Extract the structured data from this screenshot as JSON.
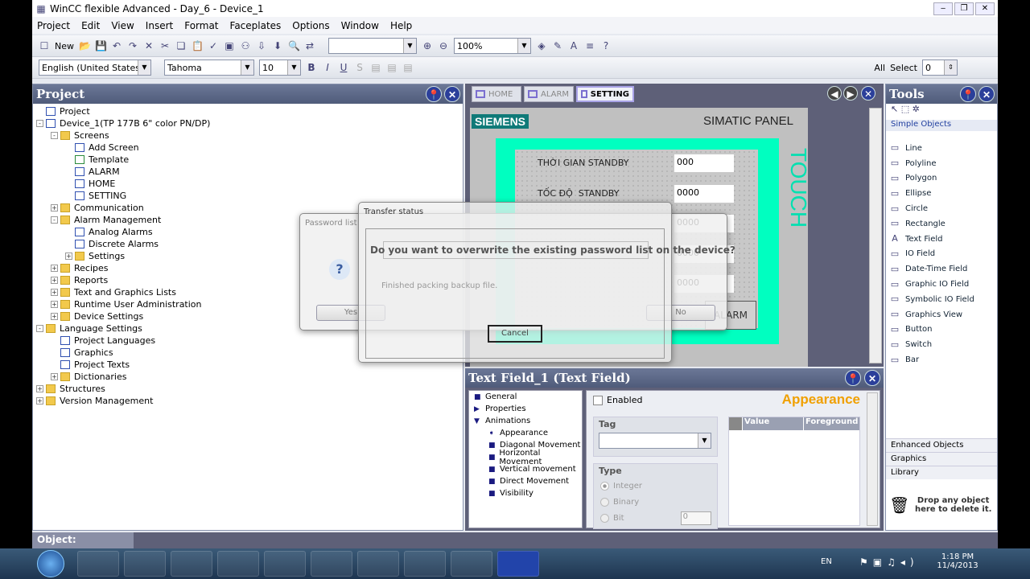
{
  "window": {
    "title": "WinCC flexible Advanced - Day_6 - Device_1"
  },
  "menu": [
    "Project",
    "Edit",
    "View",
    "Insert",
    "Format",
    "Faceplates",
    "Options",
    "Window",
    "Help"
  ],
  "toolbar": {
    "new_label": "New",
    "zoom": "100%",
    "language": "English (United States)",
    "font": "Tahoma",
    "font_size": "10",
    "all_label": "All",
    "select_label": "Select",
    "select_value": "0"
  },
  "project": {
    "title": "Project",
    "items": [
      {
        "label": "Project",
        "level": 0,
        "icon": "project"
      },
      {
        "label": "Device_1(TP 177B 6\" color PN/DP)",
        "level": 0,
        "icon": "device",
        "exp": "-"
      },
      {
        "label": "Screens",
        "level": 1,
        "icon": "folder",
        "exp": "-"
      },
      {
        "label": "Add Screen",
        "level": 2,
        "icon": "add"
      },
      {
        "label": "Template",
        "level": 2,
        "icon": "screen"
      },
      {
        "label": "ALARM",
        "level": 2,
        "icon": "screenb"
      },
      {
        "label": "HOME",
        "level": 2,
        "icon": "screenb"
      },
      {
        "label": "SETTING",
        "level": 2,
        "icon": "screenb"
      },
      {
        "label": "Communication",
        "level": 1,
        "icon": "folder",
        "exp": "+"
      },
      {
        "label": "Alarm Management",
        "level": 1,
        "icon": "folder",
        "exp": "-"
      },
      {
        "label": "Analog Alarms",
        "level": 2,
        "icon": "alarm"
      },
      {
        "label": "Discrete Alarms",
        "level": 2,
        "icon": "alarm"
      },
      {
        "label": "Settings",
        "level": 2,
        "icon": "folder",
        "exp": "+"
      },
      {
        "label": "Recipes",
        "level": 1,
        "icon": "folder",
        "exp": "+"
      },
      {
        "label": "Reports",
        "level": 1,
        "icon": "folder",
        "exp": "+"
      },
      {
        "label": "Text and Graphics Lists",
        "level": 1,
        "icon": "folder",
        "exp": "+"
      },
      {
        "label": "Runtime User Administration",
        "level": 1,
        "icon": "folder",
        "exp": "+"
      },
      {
        "label": "Device Settings",
        "level": 1,
        "icon": "folder",
        "exp": "+"
      },
      {
        "label": "Language Settings",
        "level": 0,
        "icon": "folder",
        "exp": "-"
      },
      {
        "label": "Project Languages",
        "level": 1,
        "icon": "globe"
      },
      {
        "label": "Graphics",
        "level": 1,
        "icon": "graphic"
      },
      {
        "label": "Project Texts",
        "level": 1,
        "icon": "text"
      },
      {
        "label": "Dictionaries",
        "level": 1,
        "icon": "folder",
        "exp": "+"
      },
      {
        "label": "Structures",
        "level": 0,
        "icon": "folder",
        "exp": "+"
      },
      {
        "label": "Version Management",
        "level": 0,
        "icon": "folder",
        "exp": "+"
      }
    ]
  },
  "editor": {
    "tabs": [
      "HOME",
      "ALARM",
      "SETTING"
    ],
    "active_tab": "SETTING",
    "brand": "SIEMENS",
    "panel_label": "SIMATIC PANEL",
    "touch_label": "TOUCH",
    "fields": [
      {
        "label": "THỜI GIAN STANDBY",
        "value": "000"
      },
      {
        "label": "TỐC ĐỘ  STANDBY",
        "value": "0000"
      },
      {
        "label": "",
        "value": "0000"
      },
      {
        "label": "",
        "value": "0000"
      },
      {
        "label": "",
        "value": "0000"
      }
    ],
    "alarm_button": "ALARM",
    "accent": "#00ffc0",
    "brand_color": "#0f7a78"
  },
  "properties": {
    "title": "Text Field_1 (Text Field)",
    "nav": [
      {
        "label": "General",
        "level": 0
      },
      {
        "label": "Properties",
        "level": 0
      },
      {
        "label": "Animations",
        "level": 0
      },
      {
        "label": "Appearance",
        "level": 1
      },
      {
        "label": "Diagonal Movement",
        "level": 1
      },
      {
        "label": "Horizontal Movement",
        "level": 1
      },
      {
        "label": "Vertical movement",
        "level": 1
      },
      {
        "label": "Direct Movement",
        "level": 1
      },
      {
        "label": "Visibility",
        "level": 1
      }
    ],
    "enabled_label": "Enabled",
    "section_title": "Appearance",
    "tag_label": "Tag",
    "type_label": "Type",
    "types": [
      "Integer",
      "Binary",
      "Bit"
    ],
    "bit_value": "0",
    "columns": [
      "Value",
      "Foreground C"
    ]
  },
  "tools": {
    "title": "Tools",
    "group": "Simple Objects",
    "items": [
      {
        "label": "Line",
        "icon": "line"
      },
      {
        "label": "Polyline",
        "icon": "polyline"
      },
      {
        "label": "Polygon",
        "icon": "polygon"
      },
      {
        "label": "Ellipse",
        "icon": "ellipse"
      },
      {
        "label": "Circle",
        "icon": "circle"
      },
      {
        "label": "Rectangle",
        "icon": "rectangle"
      },
      {
        "label": "Text Field",
        "icon": "A"
      },
      {
        "label": "IO Field",
        "icon": "io"
      },
      {
        "label": "Date-Time Field",
        "icon": "datetime"
      },
      {
        "label": "Graphic IO Field",
        "icon": "graphic-io"
      },
      {
        "label": "Symbolic IO Field",
        "icon": "symbolic-io"
      },
      {
        "label": "Graphics View",
        "icon": "graphics-view"
      },
      {
        "label": "Button",
        "icon": "button"
      },
      {
        "label": "Switch",
        "icon": "switch"
      },
      {
        "label": "Bar",
        "icon": "bar"
      }
    ],
    "groups": [
      "Enhanced Objects",
      "Graphics",
      "Library"
    ],
    "drop_hint": "Drop any object here to delete it."
  },
  "status": {
    "object_label": "Object:"
  },
  "password_dialog": {
    "title": "Password list",
    "message": "Do you want to overwrite the existing password list on the device?",
    "yes": "Yes",
    "no": "No"
  },
  "transfer_dialog": {
    "title": "Transfer status",
    "status": "Finished packing backup file.",
    "cancel": "Cancel"
  },
  "taskbar": {
    "lang": "EN",
    "time": "1:18 PM",
    "date": "11/4/2013"
  }
}
